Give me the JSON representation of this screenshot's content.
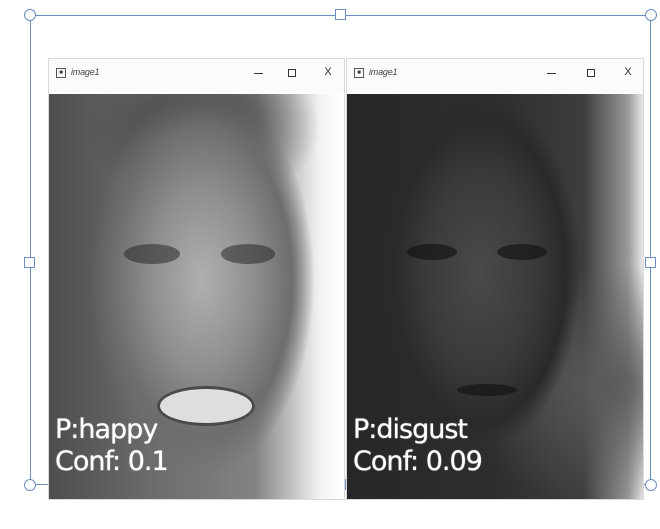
{
  "windows": [
    {
      "title": "image1",
      "prediction_label": "P:happy",
      "confidence_label": "Conf: 0.1"
    },
    {
      "title": "image1",
      "prediction_label": "P:disgust",
      "confidence_label": "Conf: 0.09"
    }
  ],
  "icons": {
    "app": "window-app-icon",
    "minimize": "minimize-icon",
    "maximize": "maximize-icon",
    "close": "close-icon"
  },
  "controls": {
    "close_glyph": "X"
  },
  "colors": {
    "selection_frame": "#6b8fc2",
    "label_text": "#ffffff"
  }
}
